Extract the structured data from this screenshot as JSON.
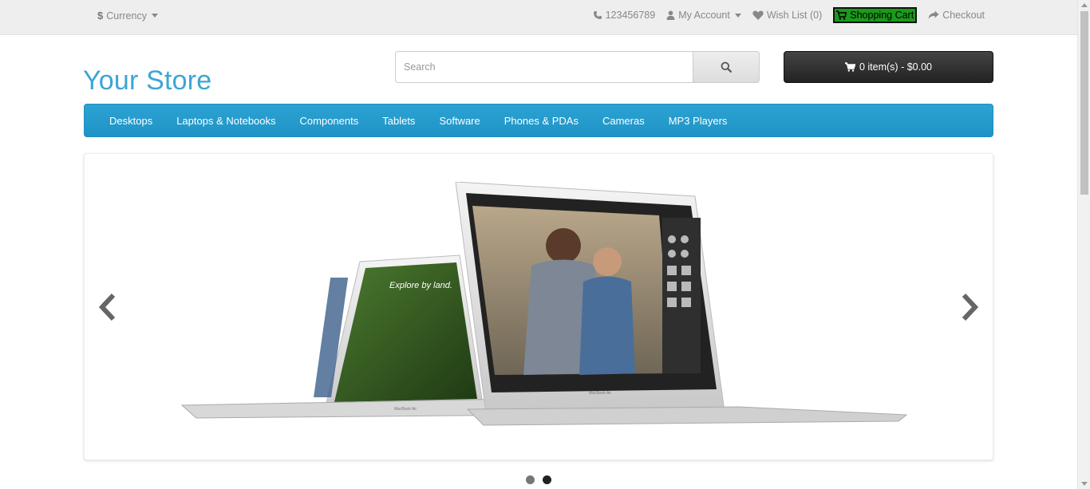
{
  "topbar": {
    "currency_symbol": "$",
    "currency_label": "Currency",
    "phone": "123456789",
    "my_account": "My Account",
    "wish_list": "Wish List (0)",
    "shopping_cart": "Shopping Cart",
    "checkout": "Checkout"
  },
  "header": {
    "logo": "Your Store",
    "search_placeholder": "Search",
    "cart_button": "0 item(s) - $0.00"
  },
  "menu": {
    "items": [
      {
        "label": "Desktops"
      },
      {
        "label": "Laptops & Notebooks"
      },
      {
        "label": "Components"
      },
      {
        "label": "Tablets"
      },
      {
        "label": "Software"
      },
      {
        "label": "Phones & PDAs"
      },
      {
        "label": "Cameras"
      },
      {
        "label": "MP3 Players"
      }
    ]
  },
  "slideshow": {
    "small_screen_text": "Explore by land.",
    "brand_label": "MacBook Air",
    "active_slide": 2,
    "slide_count": 2
  },
  "colors": {
    "accent": "#2ca3d4",
    "logo": "#3ca5d6",
    "highlight": "#1a9b1a"
  }
}
